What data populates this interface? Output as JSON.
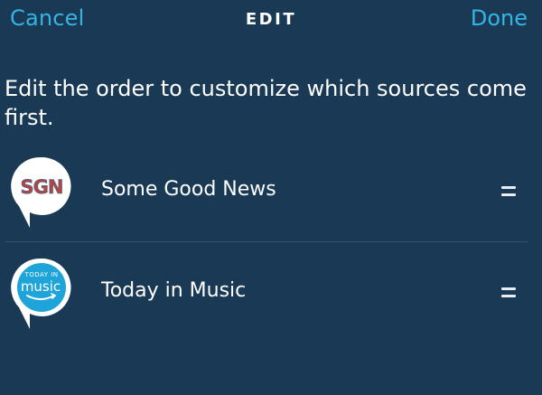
{
  "header": {
    "cancel_label": "Cancel",
    "title": "EDIT",
    "done_label": "Done"
  },
  "instructions": "Edit the order to customize which sources come first.",
  "sources": [
    {
      "label": "Some Good News",
      "logo_text": "SGN",
      "icon": "some-good-news-logo"
    },
    {
      "label": "Today in Music",
      "logo_text_top": "TODAY IN",
      "logo_text_main": "music",
      "icon": "amazon-music-logo"
    }
  ],
  "colors": {
    "background": "#1a3954",
    "accent": "#33b5e5",
    "text": "#ffffff",
    "divider": "#2e5470"
  }
}
